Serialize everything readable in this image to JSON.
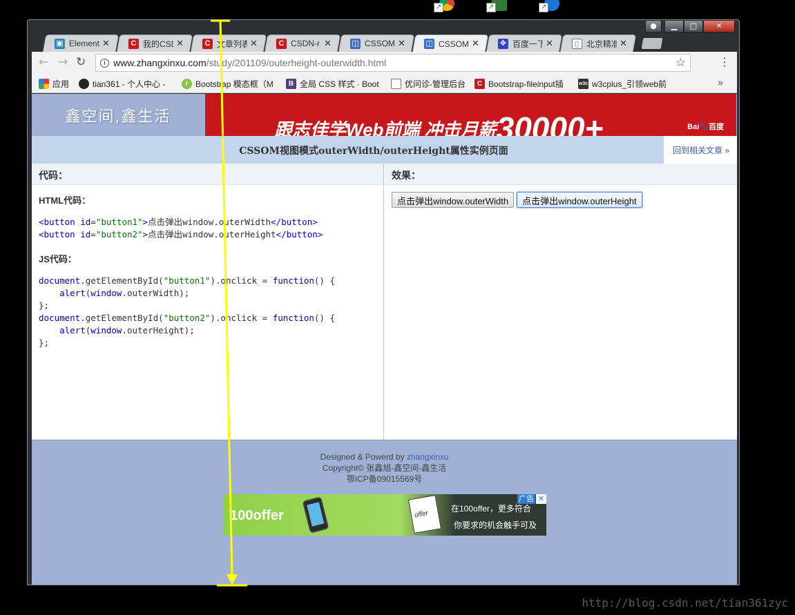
{
  "colors": {
    "banner_red": "#c8171c",
    "header_blue": "#a0b1d6",
    "title_bar": "#c3d5ed",
    "measure_arrow": "#ffff00",
    "link": "#3a5fa5"
  },
  "tabs": [
    {
      "title": "Element",
      "icon": "book-icon",
      "active": false
    },
    {
      "title": "我的CSD",
      "icon": "csdn-icon",
      "active": false
    },
    {
      "title": "文章列表",
      "icon": "csdn-icon",
      "active": false
    },
    {
      "title": "CSDN-r",
      "icon": "csdn-icon",
      "active": false
    },
    {
      "title": "CSSOM",
      "icon": "site-icon",
      "active": false
    },
    {
      "title": "CSSOM",
      "icon": "site-icon",
      "active": true
    },
    {
      "title": "百度一下",
      "icon": "baidu-paw-icon",
      "active": false
    },
    {
      "title": "北京精准",
      "icon": "page-icon",
      "active": false
    }
  ],
  "toolbar": {
    "url_host": "www.zhangxinxu.com",
    "url_path": "/study/201109/outerheight-outerwidth.html"
  },
  "bookmarks": [
    {
      "label": "应用",
      "icon": "apps-grid-icon"
    },
    {
      "label": "tian361 - 个人中心 -",
      "icon": "penguin-icon"
    },
    {
      "label": "Bootstrap 模态框（M",
      "icon": "runoob-icon"
    },
    {
      "label": "全局 CSS 样式 · Boot",
      "icon": "bootstrap-icon"
    },
    {
      "label": "优问诊-管理后台",
      "icon": "page-icon"
    },
    {
      "label": "Bootstrap-fileinput插",
      "icon": "csdn-icon"
    },
    {
      "label": "w3cplus_引领web前",
      "icon": "w3c-icon"
    }
  ],
  "page": {
    "logo_text": "鑫空间,鑫生活",
    "banner_slogan": "跟志佳学Web前端  冲击月薪",
    "banner_number": "30000+",
    "banner_brand": "Bai",
    "banner_brand_cn": "百度",
    "title": "CSSOM视图模式outerWidth/outerHeight属性实例页面",
    "back_link": "回到相关文章",
    "back_link_arrow": "»"
  },
  "left_panel": {
    "heading": "代码：",
    "html_label": "HTML代码：",
    "js_label": "JS代码："
  },
  "right_panel": {
    "heading": "效果：",
    "button1": "点击弹出window.outerWidth",
    "button2": "点击弹出window.outerHeight"
  },
  "footer": {
    "designed_prefix": "Designed & Powerd by ",
    "author": "zhangxinxu",
    "copyright": "Copyright© 张鑫旭-鑫空间-鑫生活",
    "icp": "鄂ICP备09015569号"
  },
  "ad": {
    "brand": "100offer",
    "letter": "offer",
    "line1": "在100offer，更多符合",
    "line2": "你要求的机会触手可及",
    "tag": "广告"
  },
  "watermark": "http://blog.csdn.net/tian361zyc"
}
